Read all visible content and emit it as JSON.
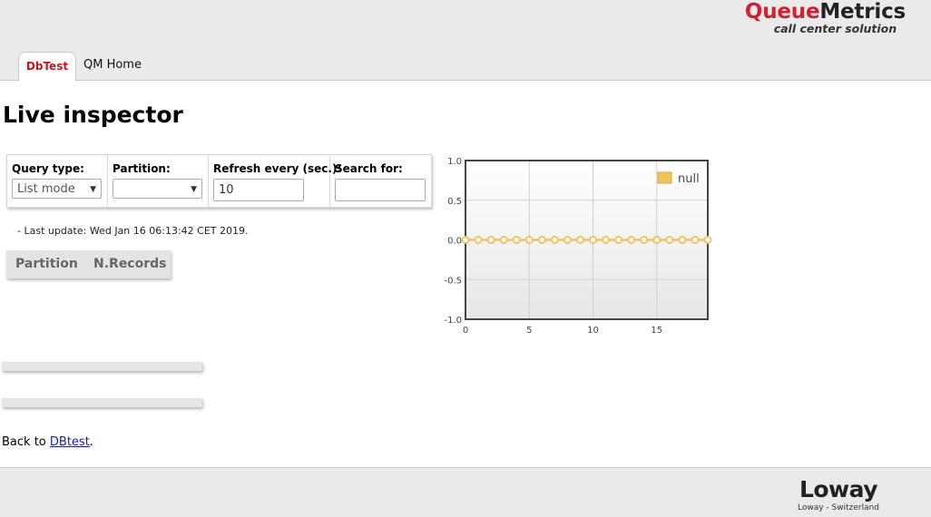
{
  "header": {
    "logo_part1": "Queue",
    "logo_part2": "Metrics",
    "tagline": "call center solution",
    "tabs": [
      {
        "label": "DbTest",
        "active": true
      },
      {
        "label": "QM Home",
        "active": false
      }
    ]
  },
  "page": {
    "title": "Live inspector"
  },
  "form": {
    "query_type": {
      "label": "Query type:",
      "value": "List mode"
    },
    "partition": {
      "label": "Partition:",
      "value": ""
    },
    "refresh": {
      "label": "Refresh every (sec.):",
      "value": "10"
    },
    "search": {
      "label": "Search for:",
      "value": ""
    }
  },
  "status": {
    "last_update": "- Last update: Wed Jan 16 06:13:42 CET 2019."
  },
  "table": {
    "columns": [
      "Partition",
      "N.Records"
    ]
  },
  "back": {
    "prefix": "Back to ",
    "link": "DBtest",
    "suffix": "."
  },
  "footer": {
    "brand": "Loway",
    "subtitle": "Loway - Switzerland"
  },
  "colors": {
    "brand_red": "#d2202f",
    "tab_red": "#c4161c",
    "series_color": "#f2c35a"
  },
  "chart_data": {
    "type": "line",
    "series": [
      {
        "name": "null",
        "x": [
          0,
          1,
          2,
          3,
          4,
          5,
          6,
          7,
          8,
          9,
          10,
          11,
          12,
          13,
          14,
          15,
          16,
          17,
          18,
          19
        ],
        "values": [
          0,
          0,
          0,
          0,
          0,
          0,
          0,
          0,
          0,
          0,
          0,
          0,
          0,
          0,
          0,
          0,
          0,
          0,
          0,
          0
        ]
      }
    ],
    "xlim": [
      0,
      19
    ],
    "ylim": [
      -1.0,
      1.0
    ],
    "xticks": [
      "0",
      "5",
      "10",
      "15"
    ],
    "xtick_values": [
      0,
      5,
      10,
      15
    ],
    "yticks": [
      "1.0",
      "0.5",
      "0.0",
      "-0.5",
      "-1.0"
    ],
    "ytick_values": [
      1.0,
      0.5,
      0.0,
      -0.5,
      -1.0
    ],
    "grid": true,
    "legend_position": "top-right"
  }
}
